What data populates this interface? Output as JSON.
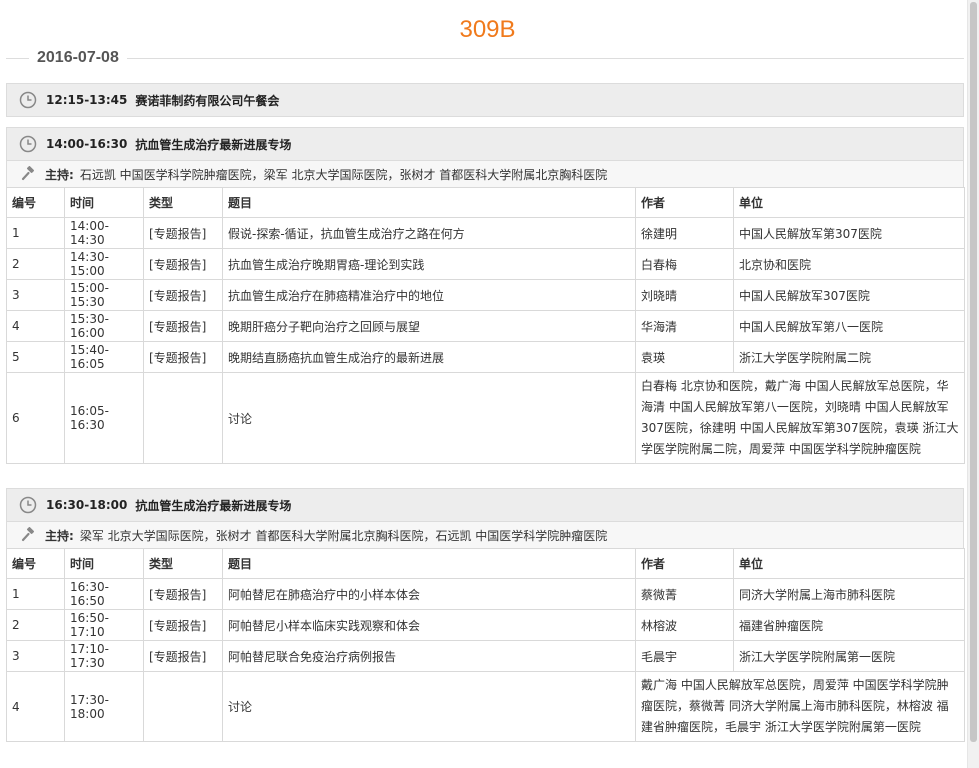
{
  "room": "309B",
  "date": "2016-07-08",
  "columns": [
    "编号",
    "时间",
    "类型",
    "题目",
    "作者",
    "单位"
  ],
  "host_label": "主持:",
  "sessions": [
    {
      "time": "12:15-13:45",
      "title": "赛诺菲制药有限公司午餐会"
    },
    {
      "time": "14:00-16:30",
      "title": "抗血管生成治疗最新进展专场",
      "hosts": "石远凯 中国医学科学院肿瘤医院，梁军 北京大学国际医院，张树才 首都医科大学附属北京胸科医院",
      "rows": [
        [
          "1",
          "14:00-14:30",
          "[专题报告]",
          "假说-探索-循证，抗血管生成治疗之路在何方",
          "徐建明",
          "中国人民解放军第307医院"
        ],
        [
          "2",
          "14:30-15:00",
          "[专题报告]",
          "抗血管生成治疗晚期胃癌-理论到实践",
          "白春梅",
          "北京协和医院"
        ],
        [
          "3",
          "15:00-15:30",
          "[专题报告]",
          "抗血管生成治疗在肺癌精准治疗中的地位",
          "刘晓晴",
          "中国人民解放军307医院"
        ],
        [
          "4",
          "15:30-16:00",
          "[专题报告]",
          "晚期肝癌分子靶向治疗之回顾与展望",
          "华海清",
          "中国人民解放军第八一医院"
        ],
        [
          "5",
          "15:40-16:05",
          "[专题报告]",
          "晚期结直肠癌抗血管生成治疗的最新进展",
          "袁瑛",
          "浙江大学医学院附属二院"
        ],
        [
          "6",
          "16:05-16:30",
          "",
          "讨论",
          "白春梅 北京协和医院，戴广海 中国人民解放军总医院，华海清 中国人民解放军第八一医院，刘晓晴 中国人民解放军307医院，徐建明 中国人民解放军第307医院，袁瑛 浙江大学医学院附属二院，周爱萍 中国医学科学院肿瘤医院",
          ""
        ]
      ]
    },
    {
      "time": "16:30-18:00",
      "title": "抗血管生成治疗最新进展专场",
      "hosts": "梁军 北京大学国际医院，张树才 首都医科大学附属北京胸科医院，石远凯 中国医学科学院肿瘤医院",
      "rows": [
        [
          "1",
          "16:30-16:50",
          "[专题报告]",
          "阿帕替尼在肺癌治疗中的小样本体会",
          "蔡微菁",
          "同济大学附属上海市肺科医院"
        ],
        [
          "2",
          "16:50-17:10",
          "[专题报告]",
          "阿帕替尼小样本临床实践观察和体会",
          "林榕波",
          "福建省肿瘤医院"
        ],
        [
          "3",
          "17:10-17:30",
          "[专题报告]",
          "阿帕替尼联合免疫治疗病例报告",
          "毛晨宇",
          "浙江大学医学院附属第一医院"
        ],
        [
          "4",
          "17:30-18:00",
          "",
          "讨论",
          "戴广海 中国人民解放军总医院，周爱萍 中国医学科学院肿瘤医院，蔡微菁 同济大学附属上海市肺科医院，林榕波 福建省肿瘤医院，毛晨宇 浙江大学医学院附属第一医院",
          ""
        ]
      ]
    }
  ]
}
